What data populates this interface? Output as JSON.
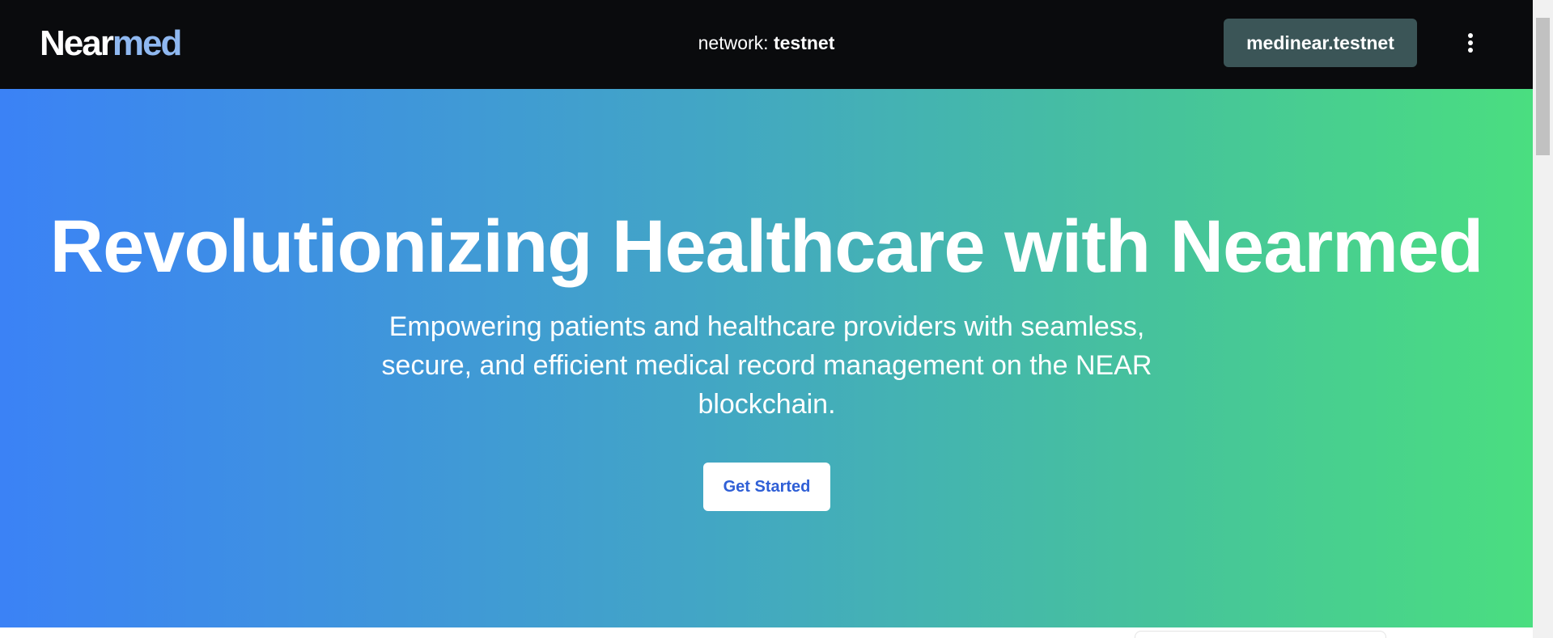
{
  "header": {
    "brand_part1": "Near",
    "brand_part2": "med",
    "network_label": "network:",
    "network_value": "testnet",
    "account_label": "medinear.testnet",
    "menu_icon": "more-vertical-icon"
  },
  "hero": {
    "title": "Revolutionizing Healthcare with Nearmed",
    "subtitle": "Empowering patients and healthcare providers with seamless, secure, and efficient medical record management on the NEAR blockchain.",
    "cta_label": "Get Started"
  },
  "colors": {
    "navbar_bg": "#0a0b0d",
    "brand_accent": "#8fb8f0",
    "account_button_bg": "#3b5557",
    "gradient_start": "#3b82f6",
    "gradient_end": "#4ade80",
    "cta_text": "#2f5fd6"
  }
}
